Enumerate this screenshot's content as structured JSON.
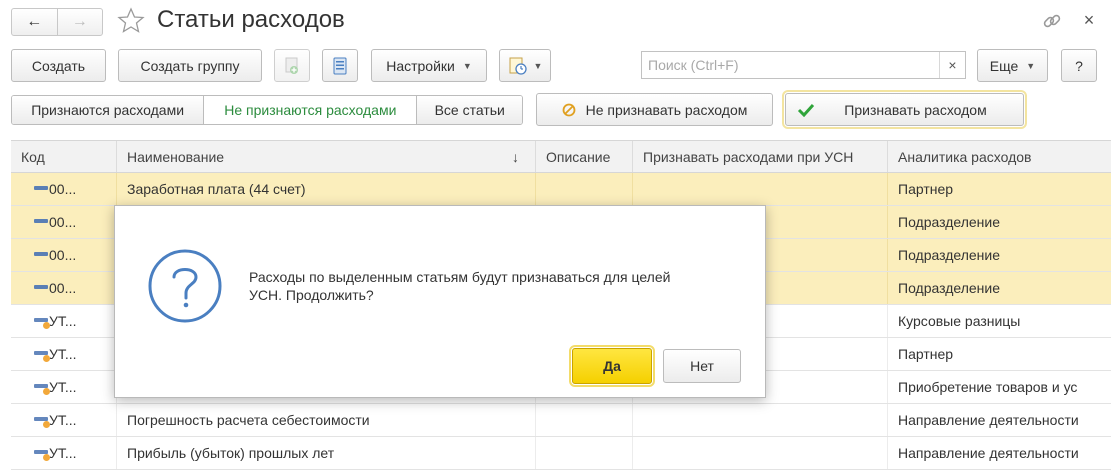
{
  "window": {
    "title": "Статьи расходов",
    "back_icon": "arrow-left-icon",
    "forward_icon": "arrow-right-icon",
    "star_icon": "star-icon",
    "link_icon": "link-icon",
    "close_label": "×"
  },
  "toolbar": {
    "create": "Создать",
    "create_group": "Создать группу",
    "settings": "Настройки",
    "more": "Еще",
    "help": "?",
    "search_placeholder": "Поиск (Ctrl+F)",
    "search_clear": "×"
  },
  "filters": {
    "tabs": [
      {
        "label": "Признаются расходами",
        "active": false
      },
      {
        "label": "Не признаются расходами",
        "active": true
      },
      {
        "label": "Все статьи",
        "active": false
      }
    ],
    "not_recognize": "Не признавать расходом",
    "recognize": "Признавать расходом"
  },
  "table": {
    "columns": [
      "Код",
      "Наименование",
      "Описание",
      "Признавать расходами при УСН",
      "Аналитика расходов"
    ],
    "rows": [
      {
        "code": "00...",
        "name": "Заработная плата (44 счет)",
        "desc": "",
        "usn": "",
        "analytics": "Партнер",
        "selected": true,
        "kind": "std"
      },
      {
        "code": "00...",
        "name": "",
        "desc": "",
        "usn": "",
        "analytics": "Подразделение",
        "selected": true,
        "kind": "std"
      },
      {
        "code": "00...",
        "name": "",
        "desc": "",
        "usn": "",
        "analytics": "Подразделение",
        "selected": true,
        "kind": "std"
      },
      {
        "code": "00...",
        "name": "",
        "desc": "",
        "usn": "",
        "analytics": "Подразделение",
        "selected": true,
        "kind": "std"
      },
      {
        "code": "УТ...",
        "name": "",
        "desc": "",
        "usn": "",
        "analytics": "Курсовые разницы",
        "selected": false,
        "kind": "ut"
      },
      {
        "code": "УТ...",
        "name": "",
        "desc": "",
        "usn": "",
        "analytics": "Партнер",
        "selected": false,
        "kind": "ut"
      },
      {
        "code": "УТ...",
        "name": "",
        "desc": "",
        "usn": "",
        "analytics": "Приобретение товаров и ус",
        "selected": false,
        "kind": "ut"
      },
      {
        "code": "УТ...",
        "name": "Погрешность расчета себестоимости",
        "desc": "",
        "usn": "",
        "analytics": "Направление деятельности",
        "selected": false,
        "kind": "ut"
      },
      {
        "code": "УТ...",
        "name": "Прибыль (убыток) прошлых лет",
        "desc": "",
        "usn": "",
        "analytics": "Направление деятельности",
        "selected": false,
        "kind": "ut"
      }
    ]
  },
  "dialog": {
    "message_line1": "Расходы по выделенным статьям будут признаваться для целей",
    "message_line2": "УСН. Продолжить?",
    "yes": "Да",
    "no": "Нет",
    "icon": "question-circle-icon"
  },
  "colors": {
    "selected_row": "#fbeebc",
    "active_tab_text": "#2c8c3e",
    "primary_button": "#f5d000",
    "icon_blue": "#4a7fc1"
  }
}
